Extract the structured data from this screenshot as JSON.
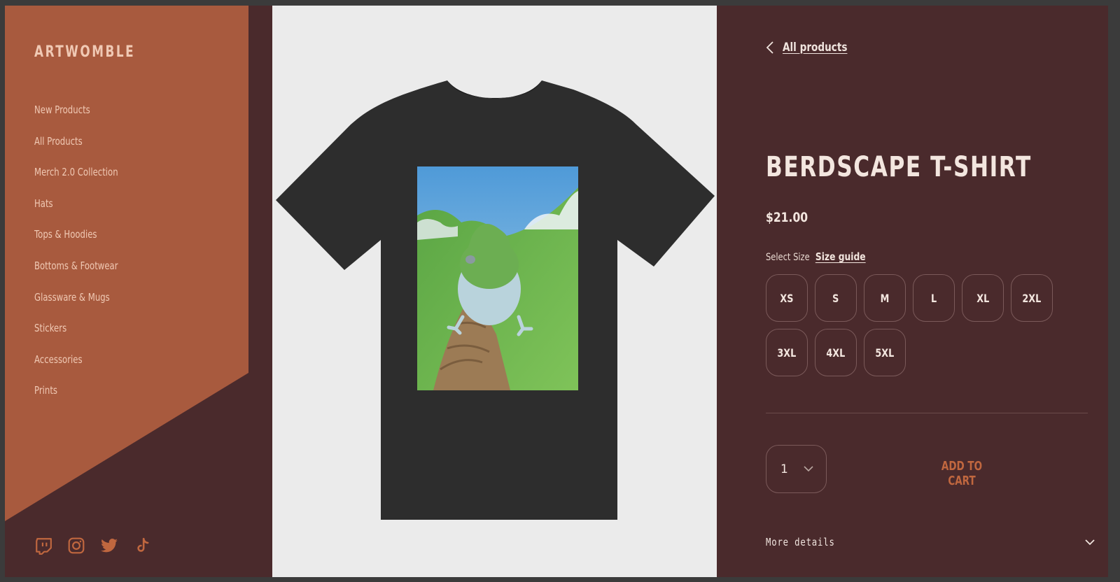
{
  "brand": "ARTWOMBLE",
  "colors": {
    "sidebar": "#a85a3e",
    "background": "#4a2a2c",
    "accent": "#c0673f",
    "image_bg": "#ebebeb"
  },
  "nav": [
    {
      "label": "New Products"
    },
    {
      "label": "All Products"
    },
    {
      "label": "Merch 2.0 Collection"
    },
    {
      "label": "Hats"
    },
    {
      "label": "Tops & Hoodies"
    },
    {
      "label": "Bottoms & Footwear"
    },
    {
      "label": "Glassware & Mugs"
    },
    {
      "label": "Stickers"
    },
    {
      "label": "Accessories"
    },
    {
      "label": "Prints"
    }
  ],
  "social": [
    "twitch-icon",
    "instagram-icon",
    "twitter-icon",
    "tiktok-icon"
  ],
  "back": {
    "label": "All products",
    "icon": "chevron-left-icon"
  },
  "product": {
    "title": "BERDSCAPE T-SHIRT",
    "price": "$21.00",
    "select_size_label": "Select Size",
    "size_guide_label": "Size guide",
    "sizes": [
      "XS",
      "S",
      "M",
      "L",
      "XL",
      "2XL",
      "3XL",
      "4XL",
      "5XL"
    ],
    "quantity": "1",
    "add_to_cart_label": "ADD TO CART",
    "more_details_label": "More details"
  }
}
